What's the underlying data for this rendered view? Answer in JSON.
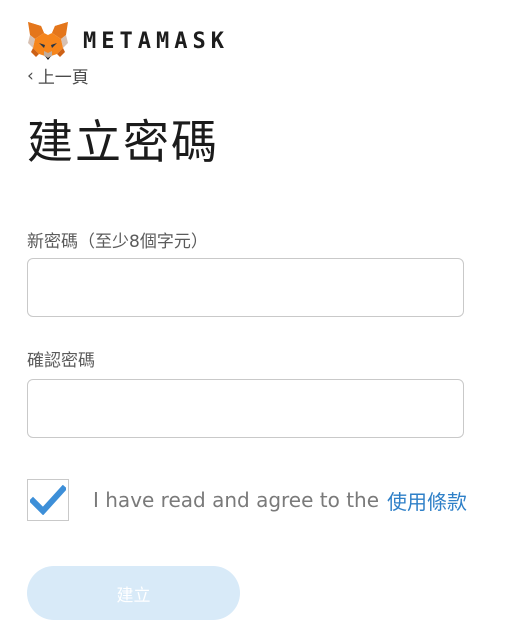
{
  "header": {
    "logo_icon": "metamask-fox-icon",
    "brand_name": "METAMASK"
  },
  "nav": {
    "back_icon": "chevron-left-icon",
    "back_label": "上一頁"
  },
  "page": {
    "title": "建立密碼"
  },
  "form": {
    "new_password": {
      "label": "新密碼（至少8個字元）",
      "value": "",
      "placeholder": ""
    },
    "confirm_password": {
      "label": "確認密碼",
      "value": "",
      "placeholder": ""
    },
    "terms": {
      "checked": true,
      "check_icon": "checkmark-icon",
      "text": "I have read and agree to the",
      "link_label": "使用條款"
    },
    "create_button_label": "建立"
  },
  "colors": {
    "link": "#2f80c8",
    "check": "#3d8fd8",
    "button_disabled_bg": "#d8eaf8",
    "button_text": "#ffffff"
  }
}
